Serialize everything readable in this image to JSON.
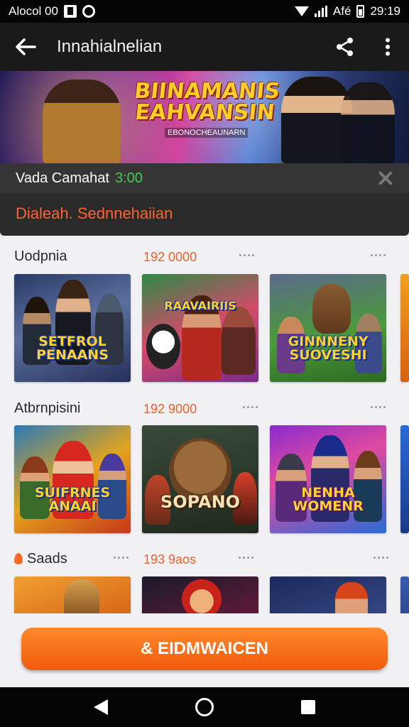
{
  "status_bar": {
    "left_text": "Alocol 00",
    "time": "29:19",
    "right_text": "Afé"
  },
  "app_bar": {
    "title": "Innahialnelian",
    "icons": [
      "back-arrow-icon",
      "share-icon",
      "more-vertical-icon"
    ]
  },
  "hero": {
    "banner_title": "BIINAMANIS\nEAHVANSIN",
    "banner_subtitle": "EBONOCHEAUNARN",
    "info_label": "Vada Camahat",
    "info_time": "3:00",
    "subtitle": "Dialeah. Sednnehaiian"
  },
  "sections": [
    {
      "name": "Uodpnia",
      "count": "192 0000",
      "cards": [
        {
          "label": "SETFROL\nPENAANS"
        },
        {
          "label": "RAAVAIRIIS"
        },
        {
          "label": "GINNNENY\nSUOVESHI"
        },
        {
          "label": ""
        }
      ]
    },
    {
      "name": "Atbrnpisini",
      "count": "192 9000",
      "cards": [
        {
          "label": "SUIFRNES\nANAAI"
        },
        {
          "label": "SOPANO"
        },
        {
          "label": "NENHA\nWOMENR"
        },
        {
          "label": ""
        }
      ]
    },
    {
      "name": "Saads",
      "count": "193 9aos",
      "cards": [
        {
          "label": ""
        },
        {
          "label": ""
        },
        {
          "label": ""
        },
        {
          "label": ""
        }
      ]
    }
  ],
  "cta": {
    "label": "& EIDMWAICEN"
  },
  "nav": {
    "icons": [
      "nav-back-icon",
      "nav-home-icon",
      "nav-recents-icon"
    ]
  }
}
